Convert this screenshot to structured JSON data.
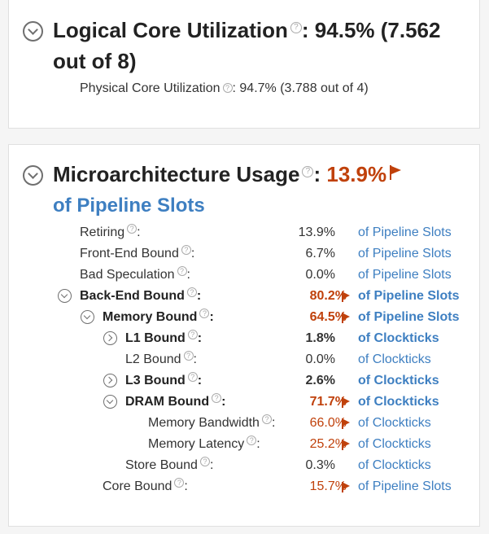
{
  "logical_core": {
    "title": "Logical Core Utilization",
    "value": ": 94.5% (7.562",
    "value_line2": "out of 8)",
    "physical_label": "Physical Core Utilization",
    "physical_value": ": 94.7% (3.788 out of 4)"
  },
  "microarch": {
    "title": "Microarchitecture Usage",
    "colon": ":",
    "value": "13.9%",
    "unit": "of Pipeline Slots",
    "rows": [
      {
        "label": "Retiring",
        "suffix": ":",
        "value": "13.9%",
        "unit": "of Pipeline Slots"
      },
      {
        "label": "Front-End Bound",
        "suffix": ":",
        "value": "6.7%",
        "unit": "of Pipeline Slots"
      },
      {
        "label": "Bad Speculation",
        "suffix": ":",
        "value": "0.0%",
        "unit": "of Pipeline Slots"
      },
      {
        "label": "Back-End Bound",
        "suffix": ":",
        "value": "80.2%",
        "unit": "of Pipeline Slots"
      },
      {
        "label": "Memory Bound",
        "suffix": ":",
        "value": "64.5%",
        "unit": "of Pipeline Slots"
      },
      {
        "label": "L1 Bound",
        "suffix": ":",
        "value": "1.8%",
        "unit": "of Clockticks"
      },
      {
        "label": "L2 Bound",
        "suffix": ":",
        "value": "0.0%",
        "unit": "of Clockticks"
      },
      {
        "label": "L3 Bound",
        "suffix": ":",
        "value": "2.6%",
        "unit": "of Clockticks"
      },
      {
        "label": "DRAM Bound",
        "suffix": ":",
        "value": "71.7%",
        "unit": "of Clockticks"
      },
      {
        "label": "Memory Bandwidth",
        "suffix": ":",
        "value": "66.0%",
        "unit": "of Clockticks"
      },
      {
        "label": "Memory Latency",
        "suffix": ":",
        "value": "25.2%",
        "unit": "of Clockticks"
      },
      {
        "label": "Store Bound",
        "suffix": ":",
        "value": "0.3%",
        "unit": "of Clockticks"
      },
      {
        "label": "Core Bound",
        "suffix": ":",
        "value": "15.7%",
        "unit": "of Pipeline Slots"
      }
    ]
  },
  "colors": {
    "flag": "#c0410b",
    "link": "#3e7fc1"
  },
  "icons": {
    "help": "?"
  }
}
